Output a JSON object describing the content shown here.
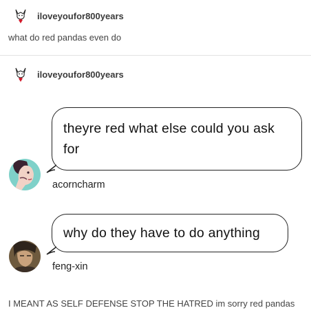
{
  "post1": {
    "username": "iloveyoufor800years",
    "text": "what do red pandas even do"
  },
  "post2": {
    "username": "iloveyoufor800years",
    "messages": [
      {
        "text": "theyre red what else could you ask for",
        "author": "acorncharm"
      },
      {
        "text": "why do they have to do anything",
        "author": "feng-xin"
      }
    ],
    "caption": "I MEANT AS SELF DEFENSE STOP THE HATRED im sorry red pandas"
  },
  "colors": {
    "text": "#444444",
    "bubble_border": "#222222",
    "divider": "#e2e2e2"
  },
  "icons": {
    "user_avatar": "white-cat-red-heart-icon"
  }
}
